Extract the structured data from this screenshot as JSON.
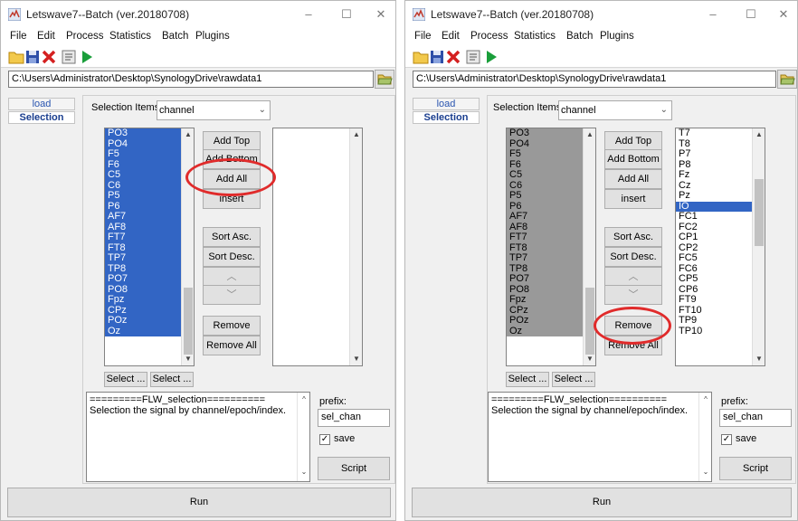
{
  "windows": [
    {
      "id": "left",
      "title": "Letswave7--Batch (ver.20180708)",
      "menu": [
        "File",
        "Edit",
        "Process",
        "Statistics",
        "Batch",
        "Plugins"
      ],
      "window_controls": [
        "–",
        "☐",
        "✕"
      ],
      "path": "C:\\Users\\Administrator\\Desktop\\SynologyDrive\\rawdata1",
      "tabs": [
        "load",
        "Selection"
      ],
      "selection_items_label": "Selection Items",
      "selection_items_value": "channel",
      "left_list": [
        "PO3",
        "PO4",
        "F5",
        "F6",
        "C5",
        "C6",
        "P5",
        "P6",
        "AF7",
        "AF8",
        "FT7",
        "FT8",
        "TP7",
        "TP8",
        "PO7",
        "PO8",
        "Fpz",
        "CPz",
        "POz",
        "Oz"
      ],
      "right_list": [],
      "buttons": {
        "add_top": "Add Top",
        "add_bottom": "Add Bottom",
        "add_all": "Add All",
        "insert": "insert",
        "sort_asc": "Sort Asc.",
        "sort_desc": "Sort Desc.",
        "up": "^",
        "down": "v",
        "remove": "Remove",
        "remove_all": "Remove All",
        "select1": "Select ...",
        "select2": "Select ...",
        "script": "Script",
        "run": "Run"
      },
      "info_text": [
        "=========FLW_selection==========",
        "Selection the signal by channel/epoch/index."
      ],
      "prefix_label": "prefix:",
      "prefix_value": "sel_chan",
      "save_label": "save",
      "save_checked": true
    },
    {
      "id": "right",
      "title": "Letswave7--Batch (ver.20180708)",
      "menu": [
        "File",
        "Edit",
        "Process",
        "Statistics",
        "Batch",
        "Plugins"
      ],
      "window_controls": [
        "–",
        "☐",
        "✕"
      ],
      "path": "C:\\Users\\Administrator\\Desktop\\SynologyDrive\\rawdata1",
      "tabs": [
        "load",
        "Selection"
      ],
      "selection_items_label": "Selection Items",
      "selection_items_value": "channel",
      "left_list": [
        "PO3",
        "PO4",
        "F5",
        "F6",
        "C5",
        "C6",
        "P5",
        "P6",
        "AF7",
        "AF8",
        "FT7",
        "FT8",
        "TP7",
        "TP8",
        "PO7",
        "PO8",
        "Fpz",
        "CPz",
        "POz",
        "Oz"
      ],
      "right_list": [
        "T7",
        "T8",
        "P7",
        "P8",
        "Fz",
        "Cz",
        "Pz",
        "IO",
        "FC1",
        "FC2",
        "CP1",
        "CP2",
        "FC5",
        "FC6",
        "CP5",
        "CP6",
        "FT9",
        "FT10",
        "TP9",
        "TP10"
      ],
      "right_list_highlighted": "IO",
      "buttons": {
        "add_top": "Add Top",
        "add_bottom": "Add Bottom",
        "add_all": "Add All",
        "insert": "insert",
        "sort_asc": "Sort Asc.",
        "sort_desc": "Sort Desc.",
        "up": "^",
        "down": "v",
        "remove": "Remove",
        "remove_all": "Remove All",
        "select1": "Select ...",
        "select2": "Select ...",
        "script": "Script",
        "run": "Run"
      },
      "info_text": [
        "=========FLW_selection==========",
        "Selection the signal by channel/epoch/index."
      ],
      "prefix_label": "prefix:",
      "prefix_value": "sel_chan",
      "save_label": "save",
      "save_checked": true
    }
  ],
  "annotations": {
    "left_highlight": "Add All",
    "right_highlight": "Remove",
    "color": "#e02b2b"
  },
  "colors": {
    "selection_blue": "#3265c4",
    "selection_gray": "#999999",
    "tab_text": "#2a55b0"
  }
}
